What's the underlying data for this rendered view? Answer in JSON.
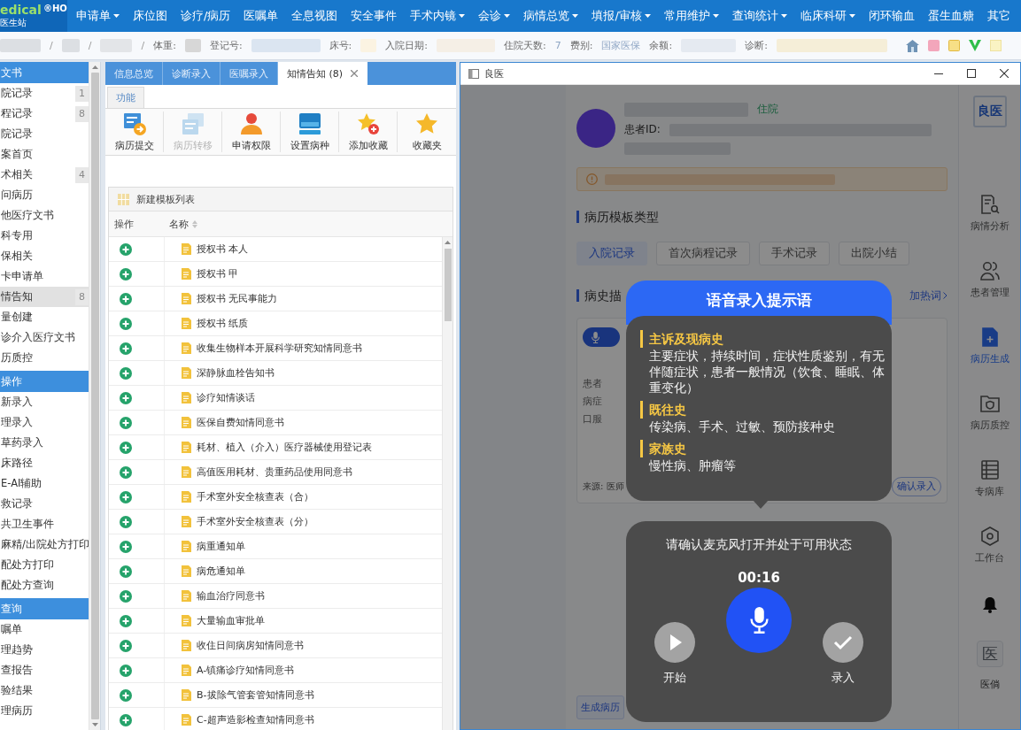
{
  "menu_bar": {
    "logo": {
      "name": "edical",
      "mark": "®HO",
      "subtitle": "医生站"
    },
    "items": [
      {
        "label": "申请单",
        "dropdown": true
      },
      {
        "label": "床位图",
        "dropdown": false
      },
      {
        "label": "诊疗/病历",
        "dropdown": false
      },
      {
        "label": "医嘱单",
        "dropdown": false
      },
      {
        "label": "全息视图",
        "dropdown": false
      },
      {
        "label": "安全事件",
        "dropdown": false
      },
      {
        "label": "手术内镜",
        "dropdown": true
      },
      {
        "label": "会诊",
        "dropdown": true
      },
      {
        "label": "病情总览",
        "dropdown": true
      },
      {
        "label": "填报/审核",
        "dropdown": true
      },
      {
        "label": "常用维护",
        "dropdown": true
      },
      {
        "label": "查询统计",
        "dropdown": true
      },
      {
        "label": "临床科研",
        "dropdown": true
      },
      {
        "label": "闭环输血",
        "dropdown": false
      },
      {
        "label": "蛋生血糖",
        "dropdown": false
      },
      {
        "label": "其它",
        "dropdown": false
      }
    ]
  },
  "patient_bar": {
    "fields": [
      {
        "kind": "redacted"
      },
      {
        "kind": "slash",
        "text": "/"
      },
      {
        "kind": "redacted"
      },
      {
        "kind": "slash",
        "text": "/"
      },
      {
        "kind": "redacted"
      },
      {
        "kind": "slash",
        "text": "/"
      },
      {
        "kind": "label",
        "text": "体重:"
      },
      {
        "kind": "redacted"
      },
      {
        "kind": "label",
        "text": "登记号:"
      },
      {
        "kind": "redacted"
      },
      {
        "kind": "label",
        "text": "床号:"
      },
      {
        "kind": "redacted"
      },
      {
        "kind": "label",
        "text": "入院日期:"
      },
      {
        "kind": "redacted"
      },
      {
        "kind": "label",
        "text": "住院天数:"
      },
      {
        "kind": "value",
        "text": "7"
      },
      {
        "kind": "label",
        "text": "费别:"
      },
      {
        "kind": "value",
        "text": "国家医保"
      },
      {
        "kind": "label",
        "text": "余额:"
      },
      {
        "kind": "redacted"
      },
      {
        "kind": "label",
        "text": "诊断:"
      },
      {
        "kind": "redacted"
      }
    ]
  },
  "sidebar": {
    "sections": [
      {
        "title": "文书",
        "items": [
          {
            "label": "院记录",
            "count": "1",
            "selected": false
          },
          {
            "label": "程记录",
            "count": "8",
            "selected": false
          },
          {
            "label": "院记录",
            "selected": false
          },
          {
            "label": "案首页",
            "selected": false
          },
          {
            "label": "术相关",
            "count": "4",
            "selected": false
          },
          {
            "label": "问病历",
            "selected": false
          },
          {
            "label": "他医疗文书",
            "selected": false
          },
          {
            "label": "科专用",
            "selected": false
          },
          {
            "label": "保相关",
            "selected": false
          },
          {
            "label": "卡申请单",
            "selected": false
          },
          {
            "label": "情告知",
            "count": "8",
            "selected": true
          },
          {
            "label": "量创建",
            "selected": false
          },
          {
            "label": "诊介入医疗文书",
            "selected": false
          },
          {
            "label": "历质控",
            "selected": false
          }
        ]
      },
      {
        "title": "操作",
        "items": [
          {
            "label": "新录入",
            "selected": false
          },
          {
            "label": "理录入",
            "selected": false
          },
          {
            "label": "草药录入",
            "selected": false
          },
          {
            "label": "床路径",
            "selected": false
          },
          {
            "label": "E-AI辅助",
            "selected": false
          },
          {
            "label": "救记录",
            "selected": false
          },
          {
            "label": "共卫生事件",
            "selected": false
          },
          {
            "label": "麻精/出院处方打印",
            "selected": false
          },
          {
            "label": "配处方打印",
            "selected": false
          },
          {
            "label": "配处方查询",
            "selected": false
          }
        ]
      },
      {
        "title": "查询",
        "items": [
          {
            "label": "嘱单",
            "selected": false
          },
          {
            "label": "理趋势",
            "selected": false
          },
          {
            "label": "查报告",
            "selected": false
          },
          {
            "label": "验结果",
            "selected": false
          },
          {
            "label": "理病历",
            "selected": false
          }
        ]
      }
    ]
  },
  "workspace": {
    "tabs": [
      {
        "label": "信息总览",
        "selected": false,
        "closable": false
      },
      {
        "label": "诊断录入",
        "selected": false,
        "closable": false
      },
      {
        "label": "医嘱录入",
        "selected": false,
        "closable": false
      },
      {
        "label": "知情告知 (8)",
        "selected": true,
        "closable": true
      }
    ],
    "ribbon": {
      "tab": "功能",
      "buttons": [
        {
          "label": "病历提交",
          "kind": "submit",
          "disabled": false
        },
        {
          "label": "病历转移",
          "kind": "transfer",
          "disabled": true
        },
        {
          "label": "申请权限",
          "kind": "permission",
          "disabled": false
        },
        {
          "label": "设置病种",
          "kind": "disease",
          "disabled": false
        },
        {
          "label": "添加收藏",
          "kind": "add_favorite",
          "disabled": false
        },
        {
          "label": "收藏夹",
          "kind": "favorites",
          "disabled": false
        }
      ]
    },
    "template_list": {
      "title": "新建模板列表",
      "columns": [
        "操作",
        "名称"
      ],
      "rows": [
        {
          "name": "授权书 本人"
        },
        {
          "name": "授权书 甲"
        },
        {
          "name": "授权书 无民事能力"
        },
        {
          "name": "授权书 纸质"
        },
        {
          "name": "收集生物样本开展科学研究知情同意书"
        },
        {
          "name": "深静脉血栓告知书"
        },
        {
          "name": "诊疗知情谈话"
        },
        {
          "name": "医保自费知情同意书"
        },
        {
          "name": "耗材、植入（介入）医疗器械使用登记表"
        },
        {
          "name": "高值医用耗材、贵重药品使用同意书"
        },
        {
          "name": "手术室外安全核查表（合）"
        },
        {
          "name": "手术室外安全核查表（分）"
        },
        {
          "name": "病重通知单"
        },
        {
          "name": "病危通知单"
        },
        {
          "name": "输血治疗同意书"
        },
        {
          "name": "大量输血审批单"
        },
        {
          "name": "收住日间病房知情同意书"
        },
        {
          "name": "A-镇痛诊疗知情同意书"
        },
        {
          "name": "B-拔除气管套管知情同意书"
        },
        {
          "name": "C-超声造影检查知情同意书"
        }
      ]
    }
  },
  "ai_window": {
    "title": "良医",
    "patient": {
      "status": "住院",
      "id_label": "患者ID:"
    },
    "template_types": {
      "title": "病历模板类型",
      "options": [
        {
          "label": "入院记录",
          "selected": true
        },
        {
          "label": "首次病程记录",
          "selected": false
        },
        {
          "label": "手术记录",
          "selected": false
        },
        {
          "label": "出院小结",
          "selected": false
        }
      ]
    },
    "history": {
      "title": "病史描",
      "hotword_link": "加热词",
      "text_lines": [
        "患者",
        "病症",
        "口服"
      ],
      "source": "来源: 医师",
      "confirm_button": "确认录入"
    },
    "generate_button": "生成病历",
    "nav": {
      "logo": "良医",
      "items": [
        {
          "label": "病情分析",
          "kind": "analysis",
          "selected": false
        },
        {
          "label": "患者管理",
          "kind": "patients",
          "selected": false
        },
        {
          "label": "病历生成",
          "kind": "generate",
          "selected": true
        },
        {
          "label": "病历质控",
          "kind": "quality",
          "selected": false
        },
        {
          "label": "专病库",
          "kind": "library",
          "selected": false
        },
        {
          "label": "工作台",
          "kind": "workbench",
          "selected": false
        }
      ],
      "user_badge": "医",
      "user_name": "医倘"
    }
  },
  "voice_tips": {
    "title": "语音录入提示语",
    "sections": [
      {
        "heading": "主诉及现病史",
        "text": "主要症状，持续时间，症状性质鉴别，有无伴随症状，患者一般情况（饮食、睡眠、体重变化）"
      },
      {
        "heading": "既往史",
        "text": "传染病、手术、过敏、预防接种史"
      },
      {
        "heading": "家族史",
        "text": "慢性病、肿瘤等"
      }
    ]
  },
  "voice_recorder": {
    "prompt": "请确认麦克风打开并处于可用状态",
    "timer": "00:16",
    "start_label": "开始",
    "enter_label": "录入"
  }
}
